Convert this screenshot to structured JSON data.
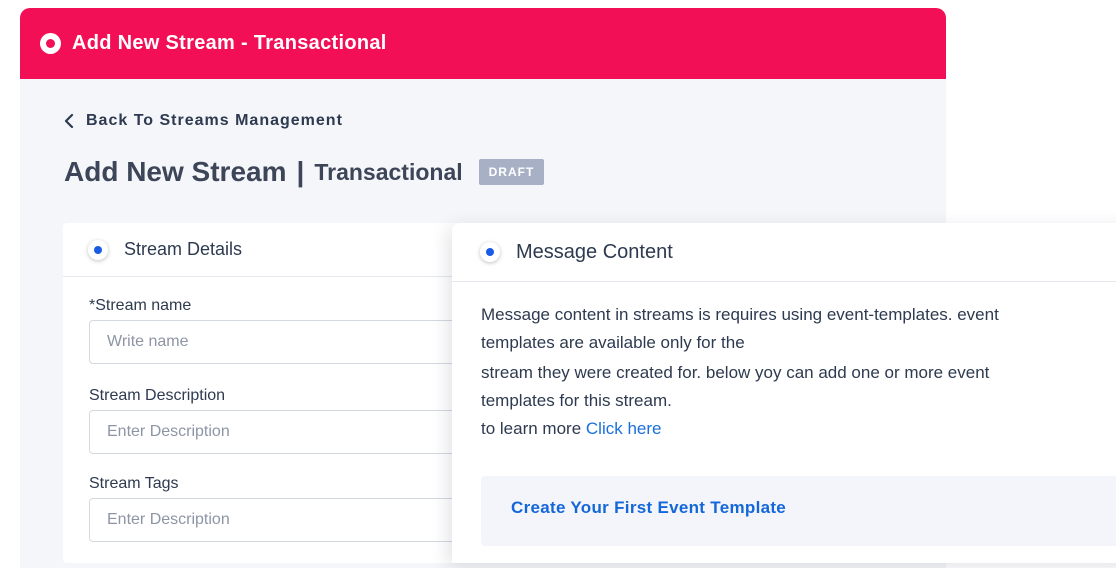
{
  "header": {
    "title": "Add New Stream - Transactional"
  },
  "back_link": {
    "label": "Back To Streams Management"
  },
  "page_heading": {
    "main": "Add New Stream",
    "separator": "|",
    "sub": "Transactional",
    "badge": "DRAFT"
  },
  "stream_details": {
    "title": "Stream Details",
    "fields": [
      {
        "label": "*Stream name",
        "placeholder": "Write name",
        "value": ""
      },
      {
        "label": "Stream Description",
        "placeholder": "Enter Description",
        "value": ""
      },
      {
        "label": "Stream Tags",
        "placeholder": "Enter Description",
        "value": ""
      }
    ]
  },
  "message_content": {
    "title": "Message Content",
    "lines": [
      "Message content in streams is requires using event-templates. event",
      "templates are available only for the",
      "stream they were created for. below yoy can add one or more event",
      "templates for this stream."
    ],
    "learn_more_prefix": "to learn more",
    "learn_more_link": "Click here",
    "create_button": "Create Your First Event Template"
  },
  "colors": {
    "brand": "#f20f55",
    "accent": "#1a5be6",
    "link": "#1a6fdc",
    "badge": "#a8b0c6"
  }
}
